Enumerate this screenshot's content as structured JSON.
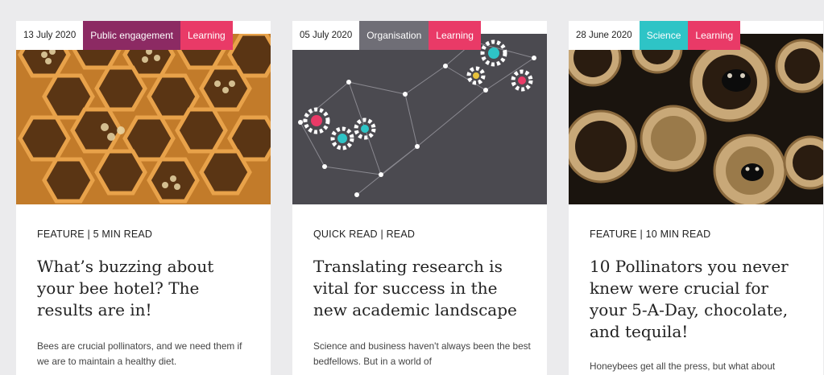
{
  "cards": [
    {
      "date": "13 July 2020",
      "tags": [
        {
          "label": "Public engagement",
          "color": "#8c2a63"
        },
        {
          "label": "Learning",
          "color": "#e93a67"
        }
      ],
      "meta": "FEATURE | 5 MIN READ",
      "title": "What’s buzzing about your bee hotel? The results are in!",
      "excerpt": "Bees are crucial pollinators, and we need them if we are to maintain a healthy diet.",
      "image_icon": "bee-hotel-photo"
    },
    {
      "date": "05 July 2020",
      "tags": [
        {
          "label": "Organisation",
          "color": "#6f6e76"
        },
        {
          "label": "Learning",
          "color": "#e93a67"
        }
      ],
      "meta": "QUICK READ | READ",
      "title": "Translating research is vital for success in the new academic landscape",
      "excerpt": "Science and business haven't always been the best bedfellows. But in a world of",
      "image_icon": "gears-network-illustration"
    },
    {
      "date": "28 June 2020",
      "tags": [
        {
          "label": "Science",
          "color": "#2ec4c6"
        },
        {
          "label": "Learning",
          "color": "#e93a67"
        }
      ],
      "meta": "FEATURE | 10 MIN READ",
      "title": "10 Pollinators you never knew were crucial for your 5-A-Day, chocolate, and tequila!",
      "excerpt": "Honeybees get all the press, but what about",
      "image_icon": "bees-in-tubes-photo"
    }
  ]
}
